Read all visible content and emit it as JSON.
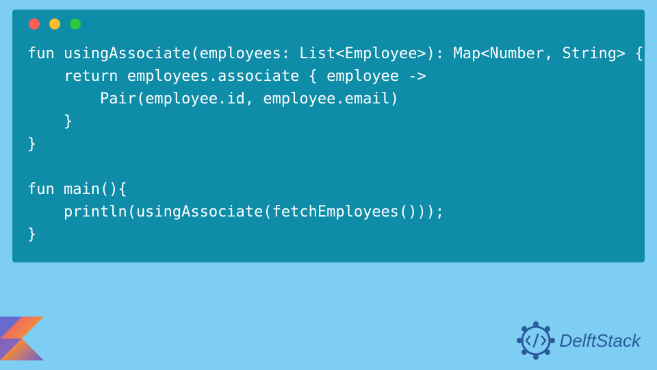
{
  "code": {
    "lines": [
      "fun usingAssociate(employees: List<Employee>): Map<Number, String> {",
      "    return employees.associate { employee ->",
      "        Pair(employee.id, employee.email)",
      "    }",
      "}",
      "",
      "fun main(){",
      "    println(usingAssociate(fetchEmployees()));",
      "}"
    ]
  },
  "brand": {
    "name": "DelftStack"
  },
  "colors": {
    "page_bg": "#7ecef4",
    "code_bg": "#0e8ca8",
    "code_fg": "#ffffff",
    "brand_text": "#2a5a9b"
  }
}
